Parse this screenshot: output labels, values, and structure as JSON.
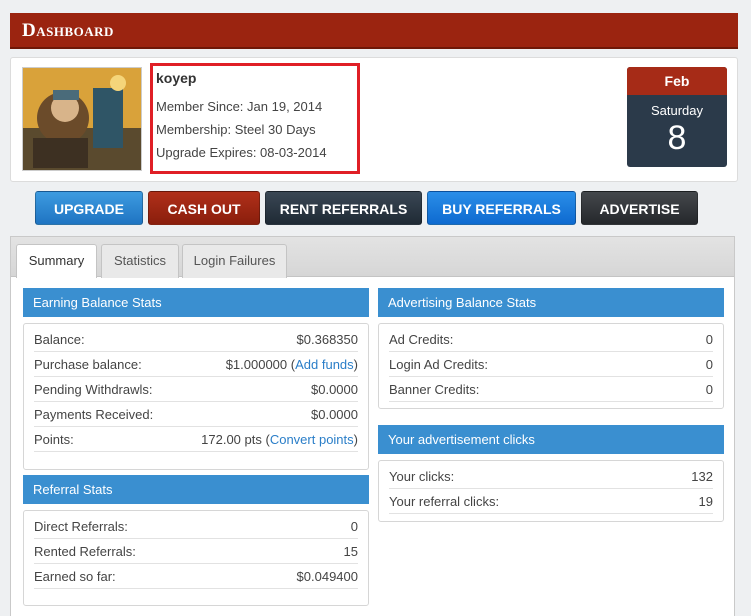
{
  "header": {
    "title": "Dashboard"
  },
  "profile": {
    "username": "koyep",
    "member_since": "Member Since: Jan 19, 2014",
    "membership": "Membership: Steel 30 Days",
    "upgrade_expires": "Upgrade Expires: 08-03-2014",
    "date": {
      "month": "Feb",
      "weekday": "Saturday",
      "day": "8"
    }
  },
  "actions": {
    "upgrade": "UPGRADE",
    "cash_out": "CASH OUT",
    "rent_referrals": "RENT REFERRALS",
    "buy_referrals": "BUY REFERRALS",
    "advertise": "ADVERTISE"
  },
  "tabs": {
    "summary": "Summary",
    "statistics": "Statistics",
    "login_failures": "Login Failures"
  },
  "earning": {
    "title": "Earning Balance Stats",
    "balance_label": "Balance:",
    "balance": "$0.368350",
    "purchase_label": "Purchase balance:",
    "purchase": "$1.000000",
    "purchase_open": "(",
    "add_funds": "Add funds",
    "purchase_close": ")",
    "pending_label": "Pending Withdrawls:",
    "pending": "$0.0000",
    "payments_label": "Payments Received:",
    "payments": "$0.0000",
    "points_label": "Points:",
    "points": "172.00 pts",
    "points_open": "(",
    "convert_points": "Convert points",
    "points_close": ")"
  },
  "referral": {
    "title": "Referral Stats",
    "direct_label": "Direct Referrals:",
    "direct": "0",
    "rented_label": "Rented Referrals:",
    "rented": "15",
    "earned_label": "Earned so far:",
    "earned": "$0.049400"
  },
  "advertising": {
    "title": "Advertising Balance Stats",
    "ad_credits_label": "Ad Credits:",
    "ad_credits": "0",
    "login_ad_label": "Login Ad Credits:",
    "login_ad": "0",
    "banner_label": "Banner Credits:",
    "banner": "0"
  },
  "clicks": {
    "title": "Your advertisement clicks",
    "your_clicks_label": "Your clicks:",
    "your_clicks": "132",
    "ref_clicks_label": "Your referral clicks:",
    "ref_clicks": "19"
  },
  "colors": {
    "header_red": "#9b2410",
    "accent_blue": "#3a8fd0",
    "date_dark": "#2b3a4a"
  }
}
